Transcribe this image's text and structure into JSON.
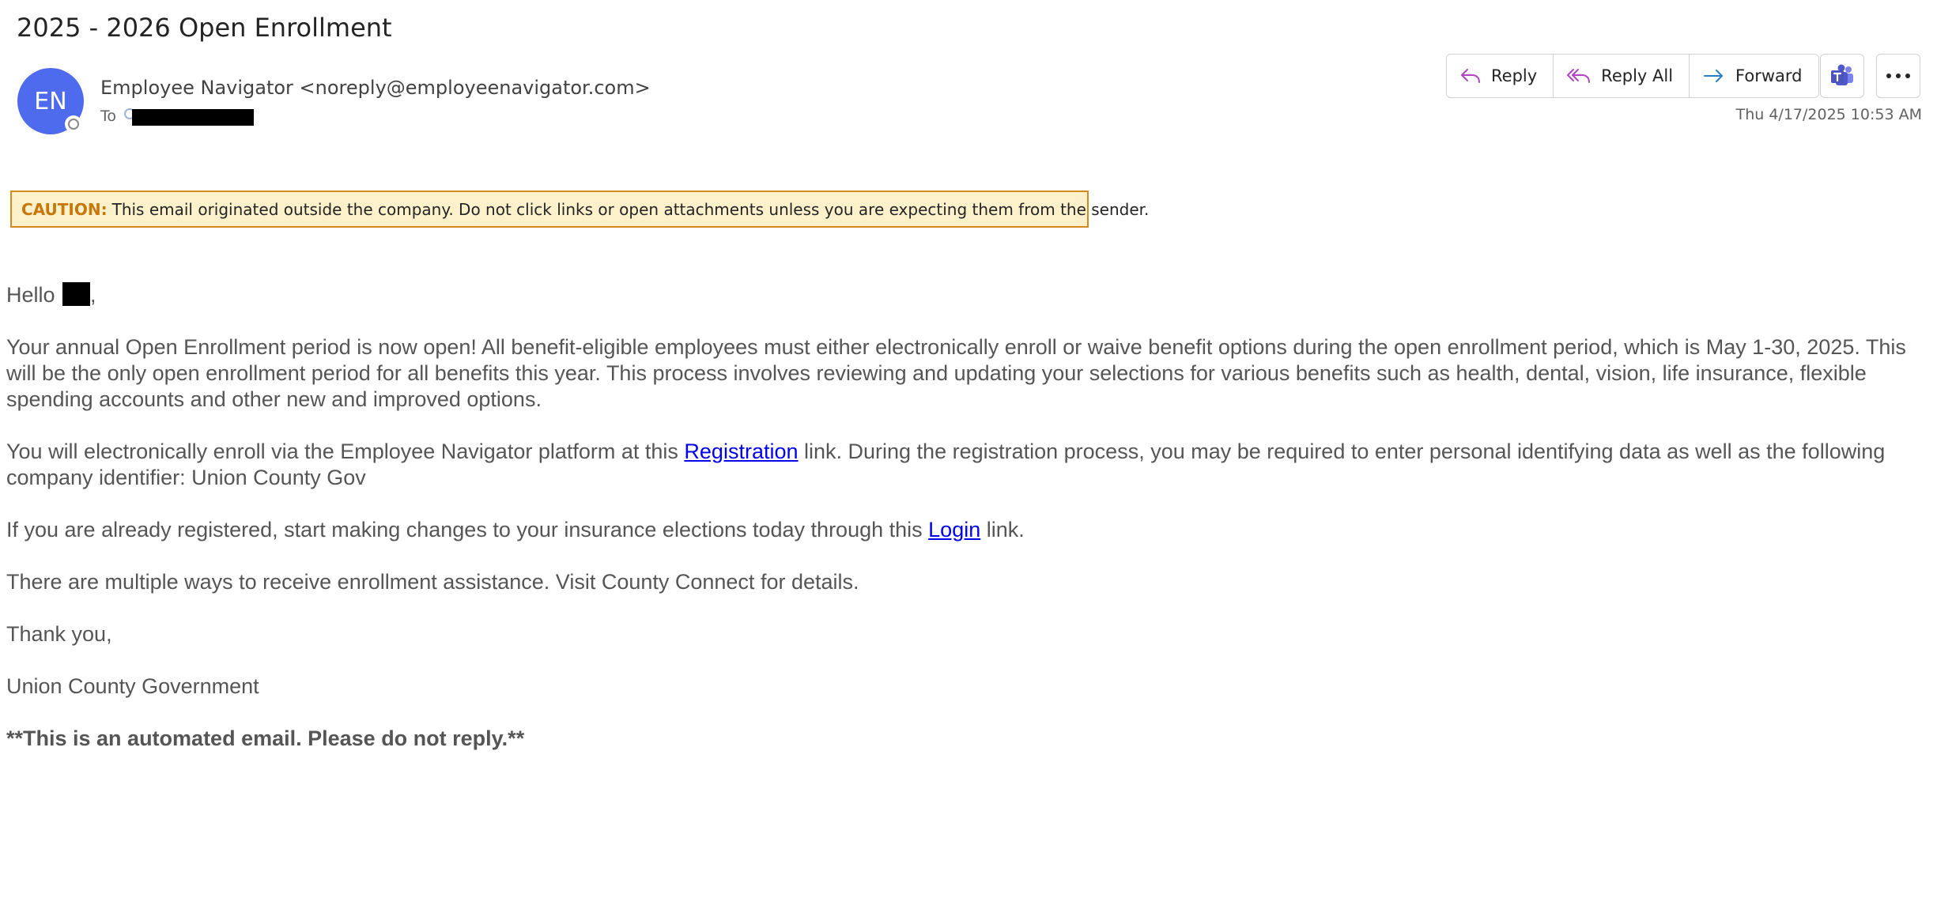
{
  "email": {
    "subject": "2025 - 2026 Open Enrollment",
    "sender": {
      "initials": "EN",
      "display": "Employee Navigator <noreply@employeenavigator.com>",
      "avatar_color": "#4f6bed"
    },
    "to_label": "To",
    "timestamp": "Thu 4/17/2025 10:53 AM"
  },
  "actions": {
    "reply": "Reply",
    "reply_all": "Reply All",
    "forward": "Forward",
    "teams_icon": "teams-icon",
    "more_icon": "more-options-icon"
  },
  "caution": {
    "label": "CAUTION:",
    "text": "This email originated outside the company. Do not click links or open attachments unless you are expecting them from the sender.",
    "background": "#fdf1cc",
    "border_color": "#d28a1e"
  },
  "body": {
    "greeting": "Hello",
    "greeting_punct": ",",
    "para1": "Your annual Open Enrollment period is now open! All benefit-eligible employees must either electronically enroll or waive benefit options during the open enrollment period, which is May 1-30, 2025. This will be the only open enrollment period for all benefits this year. This process involves reviewing and updating your selections for various benefits such as health, dental, vision, life insurance, flexible spending accounts and other new and improved options.",
    "para2_before": "You will electronically enroll via the Employee Navigator platform at this ",
    "para2_link": "Registration",
    "para2_after": " link. During the registration process, you may be required to enter personal identifying data as well as the following company identifier: Union County Gov",
    "para3_before": "If you are already registered, start making changes to your insurance elections today through this ",
    "para3_link": "Login",
    "para3_after": " link.",
    "para4": "There are multiple ways to receive enrollment assistance. Visit County Connect for details.",
    "closing": "Thank you,",
    "signature": "Union County Government",
    "note": "**This is an automated email. Please do not reply.**",
    "link_color": "#0000ee"
  }
}
